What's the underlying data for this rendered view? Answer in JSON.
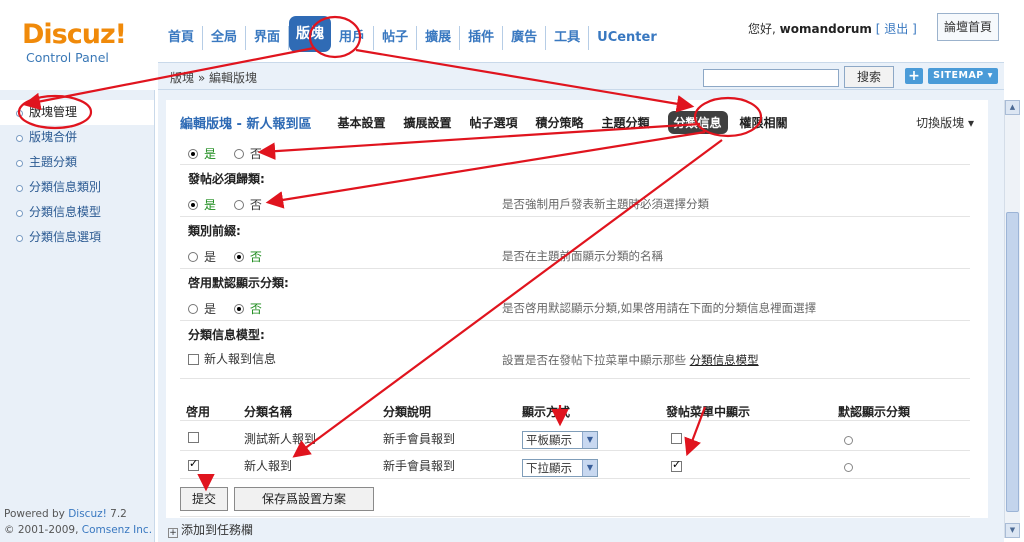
{
  "logo": {
    "title": "Discuz!",
    "subtitle": "Control Panel"
  },
  "nav": {
    "items": [
      "首頁",
      "全局",
      "界面",
      "版塊",
      "用戶",
      "帖子",
      "擴展",
      "插件",
      "廣告",
      "工具",
      "UCenter"
    ],
    "active_index": 3
  },
  "user": {
    "greeting": "您好,",
    "name": "womandorum",
    "logout": "[ 退出 ]",
    "home_button": "論壇首頁"
  },
  "crumb": {
    "text": "版塊 » 編輯版塊"
  },
  "search": {
    "placeholder": "",
    "button": "搜索",
    "plus": "+",
    "sitemap": "SITEMAP ▾"
  },
  "sidebar": {
    "items": [
      "版塊管理",
      "版塊合併",
      "主題分類",
      "分類信息類別",
      "分類信息模型",
      "分類信息選項"
    ],
    "active_index": 0,
    "footer_line1": "Powered by ",
    "footer_brand1": "Discuz!",
    "footer_ver": " 7.2",
    "footer_line2": "© 2001-2009, ",
    "footer_brand2": "Comsenz Inc."
  },
  "panel": {
    "title": "編輯版塊 - 新人報到區",
    "tabs": [
      "基本設置",
      "擴展設置",
      "帖子選項",
      "積分策略",
      "主題分類",
      "分類信息",
      "權限相關"
    ],
    "active_tab": 5,
    "switch_forum": "切換版塊 ▾"
  },
  "settings": {
    "yes": "是",
    "no": "否",
    "row0": {
      "selected": "yes"
    },
    "row1": {
      "label": "發帖必須歸類:",
      "selected": "yes",
      "hint": "是否強制用戶發表新主題時必須選擇分類"
    },
    "row2": {
      "label": "類別前綴:",
      "selected": "no",
      "hint": "是否在主題前面顯示分類的名稱"
    },
    "row3": {
      "label": "啓用默認顯示分類:",
      "selected": "no",
      "hint": "是否啓用默認顯示分類,如果啓用請在下面的分類信息裡面選擇"
    },
    "row4": {
      "label": "分類信息模型:",
      "checkbox_label": "新人報到信息",
      "checked": false,
      "hint": "設置是否在發帖下拉菜單中顯示那些 ",
      "hint_link": "分類信息模型"
    }
  },
  "table": {
    "headers": [
      "啓用",
      "分類名稱",
      "分類說明",
      "顯示方式",
      "發帖菜單中顯示",
      "默認顯示分類"
    ],
    "rows": [
      {
        "enabled": false,
        "name": "測試新人報到",
        "desc": "新手會員報到",
        "display": "平板顯示",
        "in_menu": false,
        "default": false
      },
      {
        "enabled": true,
        "name": "新人報到",
        "desc": "新手會員報到",
        "display": "下拉顯示",
        "in_menu": true,
        "default": false
      }
    ]
  },
  "buttons": {
    "submit": "提交",
    "save_scheme": "保存爲設置方案"
  },
  "bottom": {
    "add_task": "添加到任務欄",
    "box": "+"
  },
  "colors": {
    "accent": "#2f6bb5",
    "annotation": "#e0141e",
    "logo": "#f08a0a"
  }
}
